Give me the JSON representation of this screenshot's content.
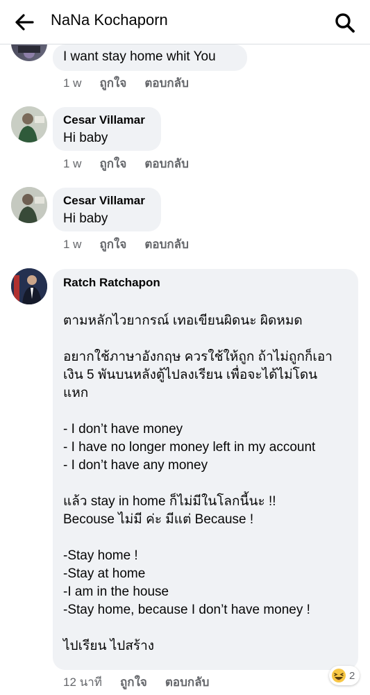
{
  "header": {
    "title": "NaNa Kochaporn"
  },
  "comments": [
    {
      "author": "",
      "text": "I want stay home whit You",
      "time": "1 w",
      "like": "ถูกใจ",
      "reply": "ตอบกลับ"
    },
    {
      "author": "Cesar Villamar",
      "text": "Hi baby",
      "time": "1 w",
      "like": "ถูกใจ",
      "reply": "ตอบกลับ"
    },
    {
      "author": "Cesar Villamar",
      "text": "Hi baby",
      "time": "1 w",
      "like": "ถูกใจ",
      "reply": "ตอบกลับ"
    },
    {
      "author": "Ratch Ratchapon",
      "lines": [
        "ตามหลักไวยากรณ์ เทอเขียนผิดนะ  ผิดหมด",
        "อยากใช้ภาษาอังกฤษ ควรใช้ให้ถูก ถ้าไม่ถูกก็เอา",
        "เงิน 5 พันบนหลังตู้ไปลงเรียน เพื่อจะได้ไม่โดน",
        "แหก",
        "- I don’t have money",
        "- I have no longer money left in my account",
        "- I don’t have any money",
        "แล้ว stay in home ก็ไม่มีในโลกนี้นะ !!",
        "Becouse ไม่มี ค่ะ มีแต่ Because !",
        "-Stay home !",
        "-Stay at home",
        "-I am in the house",
        "-Stay home, because I don’t have money !",
        "ไปเรียน ไปสร้าง"
      ],
      "time": "12 นาที",
      "like": "ถูกใจ",
      "reply": "ตอบกลับ",
      "reaction_count": "2"
    }
  ]
}
